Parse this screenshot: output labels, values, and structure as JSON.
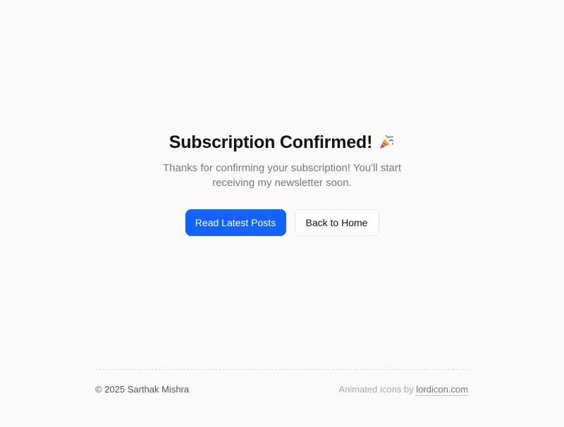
{
  "hero": {
    "title": "Subscription Confirmed!",
    "title_icon": "party-popper-icon",
    "subtitle": "Thanks for confirming your subscription! You'll start receiving my newsletter soon."
  },
  "actions": {
    "primary_label": "Read Latest Posts",
    "secondary_label": "Back to Home"
  },
  "footer": {
    "copyright": "© 2025 Sarthak Mishra",
    "credit_prefix": "Animated icons by",
    "credit_link": "lordicon.com"
  },
  "colors": {
    "accent": "#1463ff",
    "background": "#fafafa",
    "text": "#111111",
    "muted": "#7a7a7a"
  }
}
